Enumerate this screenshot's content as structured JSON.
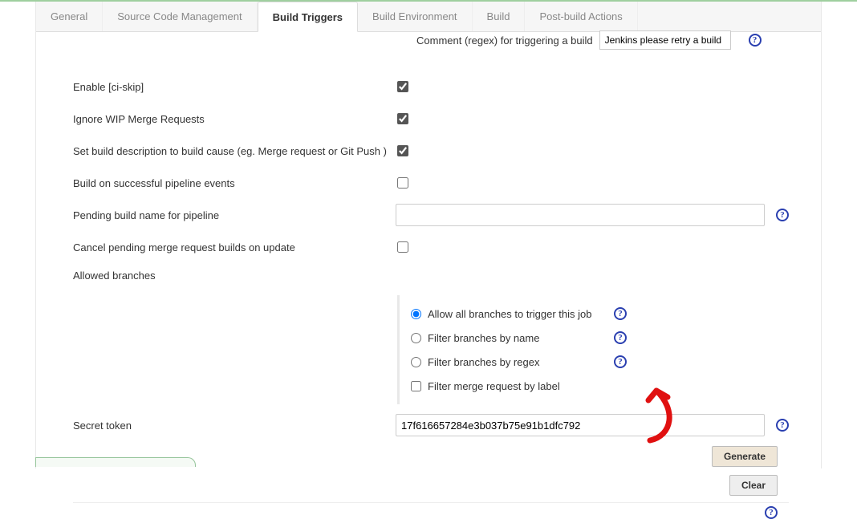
{
  "tabs": {
    "general": "General",
    "scm": "Source Code Management",
    "triggers": "Build Triggers",
    "env": "Build Environment",
    "build": "Build",
    "post": "Post-build Actions"
  },
  "partial": {
    "label": "Comment (regex) for triggering a build",
    "value": "Jenkins please retry a build"
  },
  "rows": {
    "ciskip": "Enable [ci-skip]",
    "wip": "Ignore WIP Merge Requests",
    "desc": "Set build description to build cause (eg. Merge request or Git Push )",
    "pipe_ok": "Build on successful pipeline events",
    "pending_name": "Pending build name for pipeline",
    "cancel_pending": "Cancel pending merge request builds on update",
    "allowed_branches": "Allowed branches",
    "secret_token": "Secret token"
  },
  "branches": {
    "allow_all": "Allow all branches to trigger this job",
    "by_name": "Filter branches by name",
    "by_regex": "Filter branches by regex",
    "by_label": "Filter merge request by label"
  },
  "secret": {
    "value": "17f616657284e3b037b75e91b1dfc792"
  },
  "buttons": {
    "generate": "Generate",
    "clear": "Clear"
  },
  "help": "?"
}
